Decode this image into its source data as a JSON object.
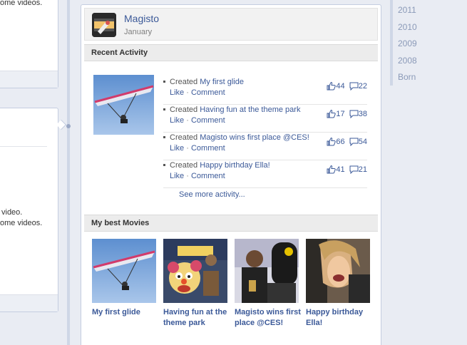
{
  "left_column": {
    "top_card_text": "ome videos.",
    "mid_card_text_1": "video.",
    "mid_card_text_2": "ome videos."
  },
  "app": {
    "name": "Magisto",
    "date": "January"
  },
  "recent_activity": {
    "header": "Recent Activity",
    "items": [
      {
        "created": "Created",
        "title": "My first glide",
        "like": "Like",
        "sep": " · ",
        "comment": "Comment",
        "likes": "44",
        "comments": "22"
      },
      {
        "created": "Created",
        "title": "Having fun at the theme park",
        "like": "Like",
        "sep": " · ",
        "comment": "Comment",
        "likes": "17",
        "comments": "38"
      },
      {
        "created": "Created",
        "title": "Magisto wins first place @CES!",
        "like": "Like",
        "sep": " · ",
        "comment": "Comment",
        "likes": "66",
        "comments": "54"
      },
      {
        "created": "Created",
        "title": "Happy birthday Ella!",
        "like": "Like",
        "sep": " · ",
        "comment": "Comment",
        "likes": "41",
        "comments": "21"
      }
    ],
    "see_more": "See more activity..."
  },
  "best_movies": {
    "header": "My best Movies",
    "movies": [
      {
        "title": "My first glide"
      },
      {
        "title": "Having fun at the theme park"
      },
      {
        "title": "Magisto wins first place @CES!"
      },
      {
        "title": "Happy birthday Ella!"
      }
    ]
  },
  "year_nav": {
    "years": [
      "2011",
      "2010",
      "2009",
      "2008",
      "Born"
    ]
  },
  "colors": {
    "link": "#3b5998",
    "accent_bg": "#e9ecf3",
    "timeline": "#cfd7e6"
  },
  "icons": {
    "like": "thumbs-up-icon",
    "comment": "comment-bubble-icon",
    "app": "magisto-app-icon"
  }
}
